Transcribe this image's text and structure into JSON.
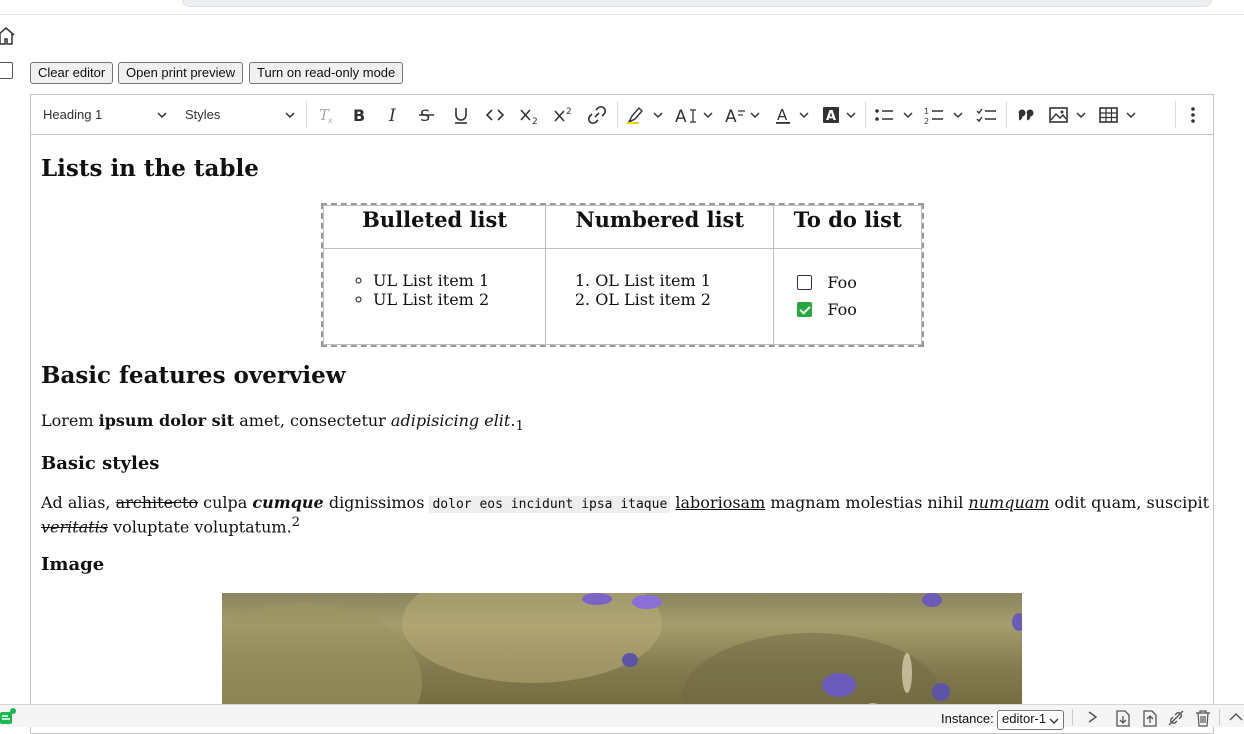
{
  "buttons": {
    "clear": "Clear editor",
    "print": "Open print preview",
    "readonly": "Turn on read-only mode"
  },
  "toolbar": {
    "heading": "Heading 1",
    "styles": "Styles",
    "icons": [
      "remove-format",
      "bold",
      "italic",
      "strikethrough",
      "underline",
      "code",
      "subscript",
      "superscript",
      "link",
      "highlight",
      "font-size",
      "font-family",
      "font-color",
      "font-background",
      "bulleted-list",
      "numbered-list",
      "todo-list",
      "block-quote",
      "insert-image",
      "insert-table",
      "more"
    ]
  },
  "content": {
    "h_lists": "Lists in the table",
    "table": {
      "headers": [
        "Bulleted list",
        "Numbered list",
        "To do list"
      ],
      "bulleted": [
        "UL List item 1",
        "UL List item 2"
      ],
      "numbered": [
        "OL List item 1",
        "OL List item 2"
      ],
      "todo": [
        {
          "label": "Foo",
          "checked": false
        },
        {
          "label": "Foo",
          "checked": true
        }
      ]
    },
    "h_basic": "Basic features overview",
    "p1": {
      "a": "Lorem ",
      "b": "ipsum dolor sit",
      "c": " amet, consectetur ",
      "d": "adipisicing elit",
      "e": ".",
      "f": "1"
    },
    "h_styles": "Basic styles",
    "p2": {
      "a": "Ad alias, ",
      "strike": "architecto",
      "b": " culpa ",
      "bi": "cumque",
      "c": " dignissimos ",
      "code": "dolor eos incidunt ipsa itaque",
      "d": " ",
      "u": "laboriosam",
      "e": " magnam molestias nihil ",
      "iu": "numquam",
      "f": " odit quam, suscipit"
    },
    "p3": {
      "strike_i": "veritatis",
      "a": " voluptate voluptatum.",
      "sup": "2"
    },
    "h_image": "Image"
  },
  "statusbar": {
    "instance_label": "Instance:",
    "instance_value": "editor-1"
  },
  "colors": {
    "todo_checked": "#25a83d",
    "table_outline": "#9a9a9a"
  }
}
